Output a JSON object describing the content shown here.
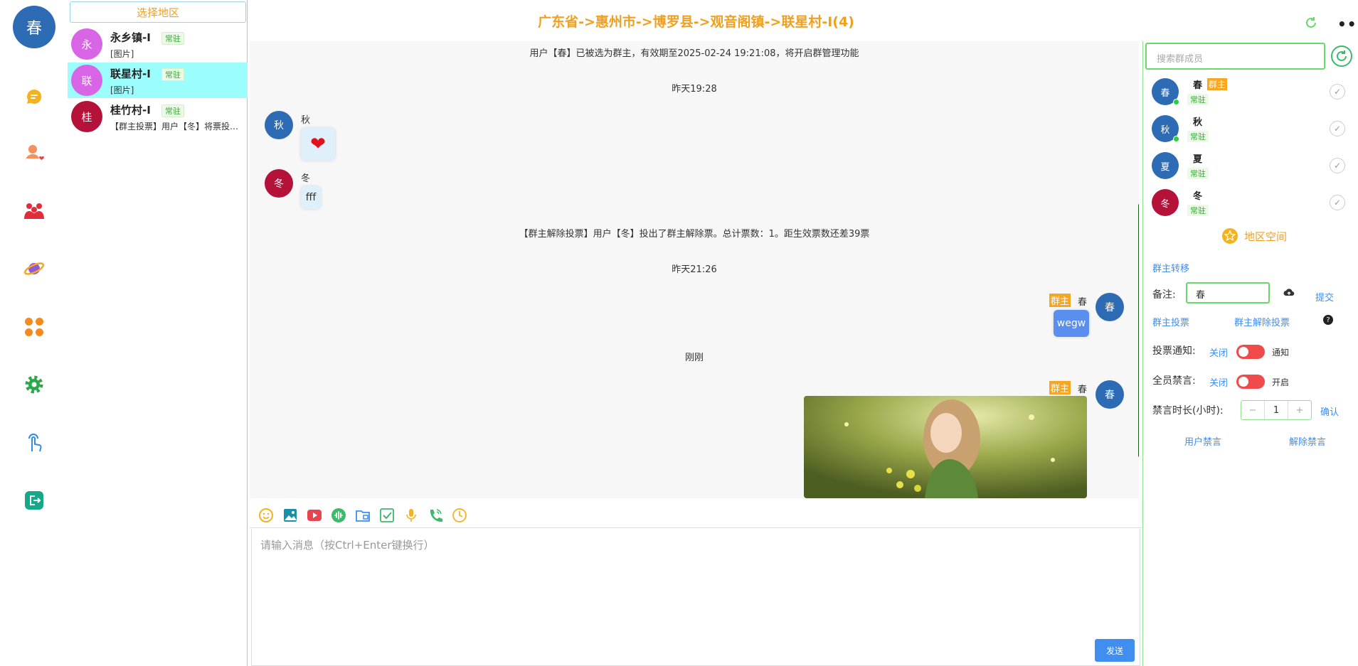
{
  "rail": {
    "me_avatar": "春",
    "items": [
      "chat",
      "contacts",
      "groups",
      "discover",
      "apps",
      "settings",
      "touch",
      "logout"
    ]
  },
  "region_button": "选择地区",
  "conversations": [
    {
      "avatar": "永",
      "name": "永乡镇-I",
      "tag": "常驻",
      "preview": "[图片]",
      "color": "#d765e6"
    },
    {
      "avatar": "联",
      "name": "联星村-I",
      "tag": "常驻",
      "preview": "[图片]",
      "color": "#d765e6"
    },
    {
      "avatar": "桂",
      "name": "桂竹村-I",
      "tag": "常驻",
      "preview": "【群主投票】用户【冬】将票投给了【春】",
      "color": "#b5123a"
    }
  ],
  "header": {
    "title": "广东省->惠州市->博罗县->观音阁镇->联星村-I(4)",
    "more": "•••"
  },
  "messages": {
    "sys1": "用户【春】已被选为群主，有效期至2025-02-24 19:21:08，将开启群管理功能",
    "time1": "昨天19:28",
    "m1": {
      "avatar": "秋",
      "sender": "秋",
      "content": "❤"
    },
    "m2": {
      "avatar": "冬",
      "sender": "冬",
      "content": "fff"
    },
    "sys2": "【群主解除投票】用户【冬】投出了群主解除票。总计票数：1。距生效票数还差39票",
    "time2": "昨天21:26",
    "m3": {
      "avatar": "春",
      "sender": "春",
      "badge": "群主",
      "content": "wegw"
    },
    "time3": "刚刚",
    "m4": {
      "avatar": "春",
      "sender": "春",
      "badge": "群主"
    }
  },
  "input": {
    "placeholder": "请输入消息（按Ctrl+Enter键换行）",
    "send": "发送"
  },
  "right": {
    "search_placeholder": "搜索群成员",
    "members": [
      {
        "avatar": "春",
        "name": "春",
        "tag": "常驻",
        "owner": "群主",
        "online": true,
        "color": "#2e6bb5"
      },
      {
        "avatar": "秋",
        "name": "秋",
        "tag": "常驻",
        "online": true,
        "color": "#2e6bb5"
      },
      {
        "avatar": "夏",
        "name": "夏",
        "tag": "常驻",
        "online": false,
        "color": "#2e6bb5"
      },
      {
        "avatar": "冬",
        "name": "冬",
        "tag": "常驻",
        "online": false,
        "color": "#b5123a"
      }
    ],
    "space": "地区空间",
    "owner_transfer": "群主转移",
    "note_label": "备注:",
    "note_value": "春",
    "submit": "提交",
    "owner_vote": "群主投票",
    "owner_unvote": "群主解除投票",
    "vote_notice_label": "投票通知:",
    "vote_notice_off": "关闭",
    "vote_notice_on": "通知",
    "mute_all_label": "全员禁言:",
    "mute_all_off": "关闭",
    "mute_all_on": "开启",
    "mute_hours_label": "禁言时长(小时):",
    "mute_hours_value": "1",
    "minus": "−",
    "plus": "+",
    "confirm": "确认",
    "user_mute": "用户禁言",
    "unmute": "解除禁言"
  }
}
